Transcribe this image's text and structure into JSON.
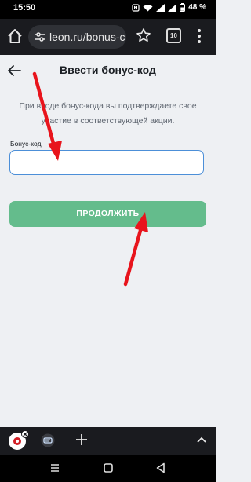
{
  "status_bar": {
    "time": "15:50",
    "battery": "48 %"
  },
  "browser": {
    "url": "leon.ru/bonus-c",
    "tab_count": "10"
  },
  "page": {
    "title": "Ввести бонус-код",
    "description": "При вводе бонус-кода вы подтверждаете свое участие в соответствующей акции.",
    "field_label": "Бонус-код",
    "field_value": "",
    "submit_label": "ПРОДОЛЖИТЬ"
  },
  "colors": {
    "accent_button": "#64bc8c",
    "input_border": "#4c8fd8",
    "annotation_arrow": "#e8141c"
  }
}
